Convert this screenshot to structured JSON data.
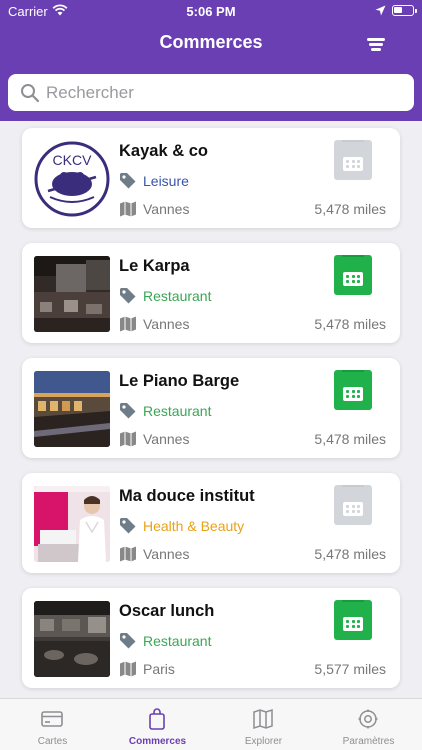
{
  "status_bar": {
    "carrier": "Carrier",
    "time": "5:06 PM"
  },
  "header": {
    "title": "Commerces",
    "filter_icon": "filter-lines-icon"
  },
  "search": {
    "placeholder": "Rechercher",
    "value": ""
  },
  "colors": {
    "brand": "#6a3fb3",
    "leisure": "#3a55a8",
    "restaurant": "#3aa655",
    "health_beauty": "#e8a21a",
    "badge_active": "#20b14b",
    "badge_inactive": "#d2d6da"
  },
  "merchants": [
    {
      "name": "Kayak & co",
      "category": "Leisure",
      "city": "Vannes",
      "distance": "5,478 miles",
      "badge_active": false
    },
    {
      "name": "Le Karpa",
      "category": "Restaurant",
      "city": "Vannes",
      "distance": "5,478 miles",
      "badge_active": true
    },
    {
      "name": "Le Piano Barge",
      "category": "Restaurant",
      "city": "Vannes",
      "distance": "5,478 miles",
      "badge_active": true
    },
    {
      "name": "Ma douce institut",
      "category": "Health & Beauty",
      "city": "Vannes",
      "distance": "5,478 miles",
      "badge_active": false
    },
    {
      "name": "Oscar lunch",
      "category": "Restaurant",
      "city": "Paris",
      "distance": "5,577 miles",
      "badge_active": true
    }
  ],
  "tabs": [
    {
      "label": "Cartes",
      "icon": "card-icon",
      "active": false
    },
    {
      "label": "Commerces",
      "icon": "bag-icon",
      "active": true
    },
    {
      "label": "Explorer",
      "icon": "map-icon",
      "active": false
    },
    {
      "label": "Paramètres",
      "icon": "settings-icon",
      "active": false
    }
  ]
}
